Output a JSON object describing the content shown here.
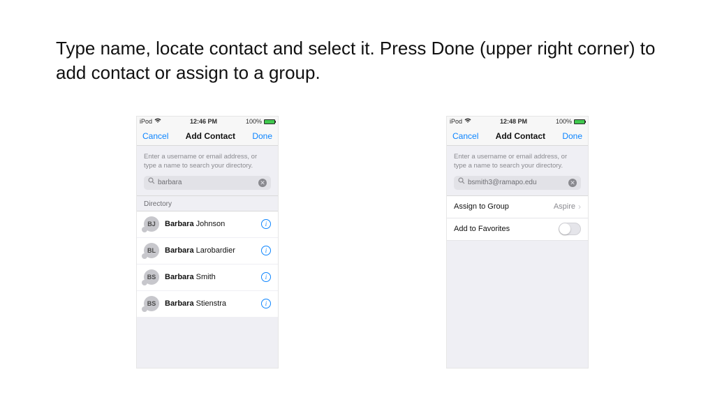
{
  "instruction": {
    "part1": "Type name, locate contact and select it.  Press ",
    "emph": "Done",
    "part2": " (upper right corner) to add contact or assign to a group."
  },
  "left": {
    "status": {
      "carrier": "iPod",
      "time": "12:46 PM",
      "battery_pct": "100%"
    },
    "nav": {
      "cancel": "Cancel",
      "title": "Add Contact",
      "done": "Done"
    },
    "helper_text": "Enter a username or email address, or type a name to search your directory.",
    "search_value": "barbara",
    "section_label": "Directory",
    "contacts": [
      {
        "initials": "BJ",
        "first": "Barbara",
        "last": "Johnson"
      },
      {
        "initials": "BL",
        "first": "Barbara",
        "last": "Larobardier"
      },
      {
        "initials": "BS",
        "first": "Barbara",
        "last": "Smith"
      },
      {
        "initials": "BS",
        "first": "Barbara",
        "last": "Stienstra"
      }
    ]
  },
  "right": {
    "status": {
      "carrier": "iPod",
      "time": "12:48 PM",
      "battery_pct": "100%"
    },
    "nav": {
      "cancel": "Cancel",
      "title": "Add Contact",
      "done": "Done"
    },
    "helper_text": "Enter a username or email address, or type a name to search your directory.",
    "search_value": "bsmith3@ramapo.edu",
    "rows": {
      "assign_label": "Assign to Group",
      "assign_value": "Aspire",
      "fav_label": "Add to Favorites"
    }
  }
}
